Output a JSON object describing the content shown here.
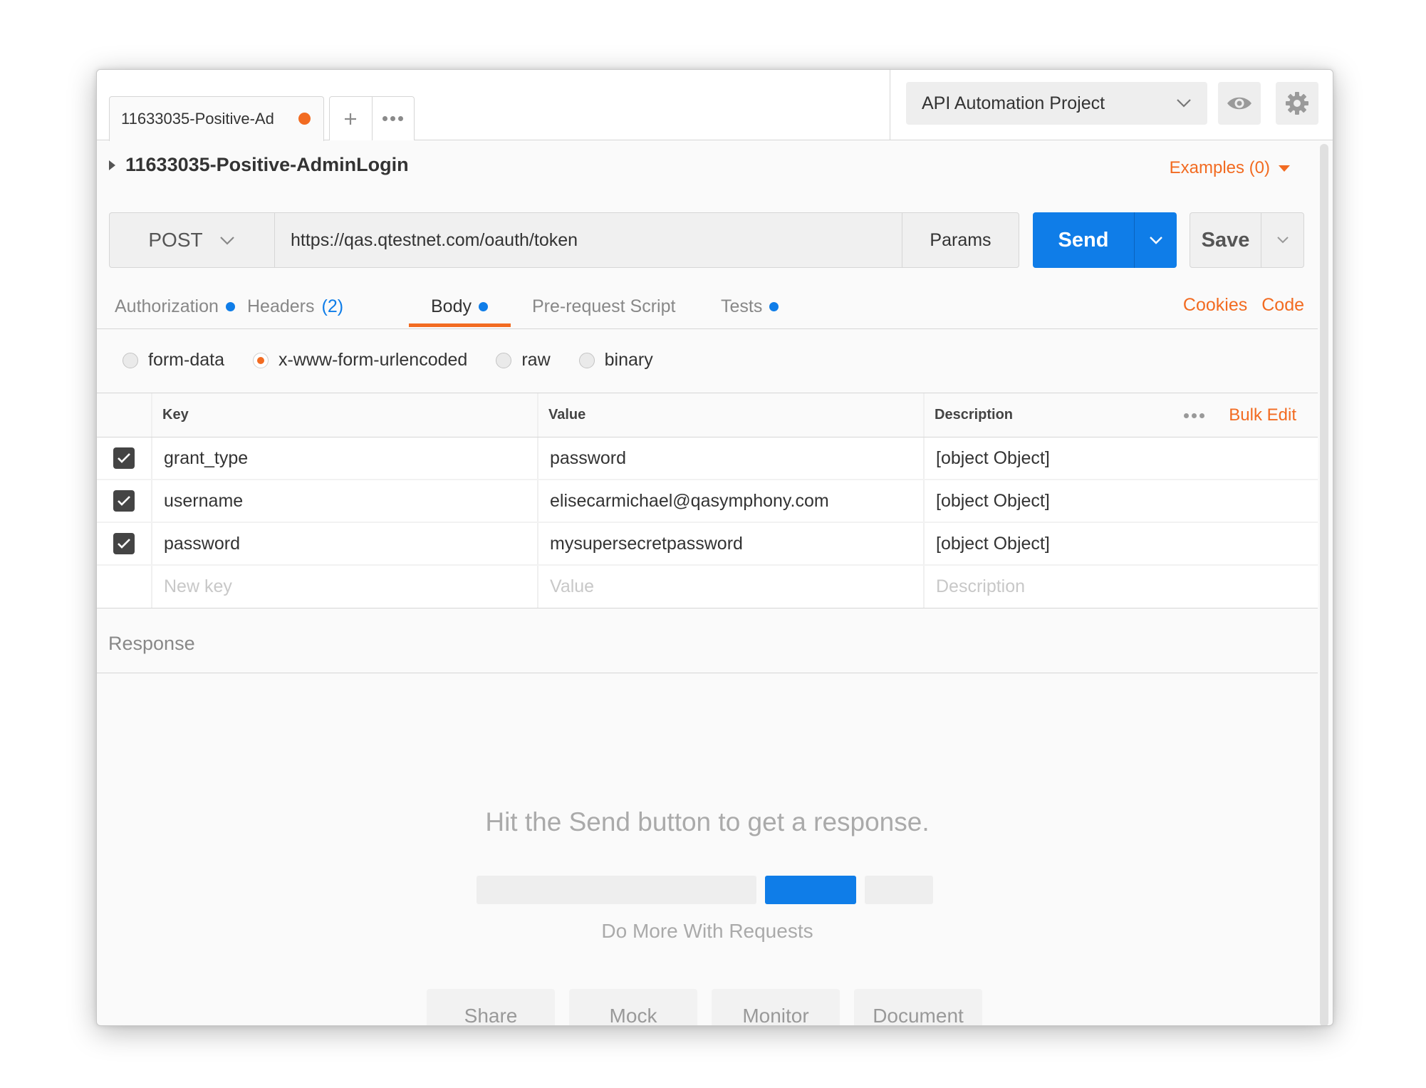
{
  "colors": {
    "accent": "#f26b21",
    "primary": "#0f7de8",
    "placeholder_gray": "#eeeeee"
  },
  "tabs": {
    "active": {
      "label": "11633035-Positive-Ad",
      "unsaved": true
    },
    "new_tab_icon": "plus-icon",
    "more_icon": "more-horizontal-icon"
  },
  "environment": {
    "selected": "API Automation Project",
    "eye_icon": "eye-icon",
    "settings_icon": "gear-icon"
  },
  "request": {
    "name": "11633035-Positive-AdminLogin",
    "examples": "Examples (0)",
    "method": "POST",
    "url": "https://qas.qtestnet.com/oauth/token",
    "params_label": "Params",
    "send_label": "Send",
    "save_label": "Save"
  },
  "subtabs": {
    "authorization": "Authorization",
    "headers": "Headers",
    "headers_count": "(2)",
    "body": "Body",
    "prerequest": "Pre-request Script",
    "tests": "Tests",
    "cookies": "Cookies",
    "code": "Code"
  },
  "body_types": {
    "form_data": "form-data",
    "urlencoded": "x-www-form-urlencoded",
    "raw": "raw",
    "binary": "binary",
    "selected": "x-www-form-urlencoded"
  },
  "table": {
    "headers": {
      "key": "Key",
      "value": "Value",
      "description": "Description",
      "bulk_edit": "Bulk Edit"
    },
    "rows": [
      {
        "checked": true,
        "key": "grant_type",
        "value": "password",
        "description": "[object Object]"
      },
      {
        "checked": true,
        "key": "username",
        "value": "elisecarmichael@qasymphony.com",
        "description": "[object Object]"
      },
      {
        "checked": true,
        "key": "password",
        "value": "mysupersecretpassword",
        "description": "[object Object]"
      }
    ],
    "new_row": {
      "key": "New key",
      "value": "Value",
      "description": "Description"
    }
  },
  "response": {
    "title": "Response",
    "hint": "Hit the Send button to get a response.",
    "do_more": "Do More With Requests",
    "actions": [
      "Share",
      "Mock",
      "Monitor",
      "Document"
    ]
  }
}
